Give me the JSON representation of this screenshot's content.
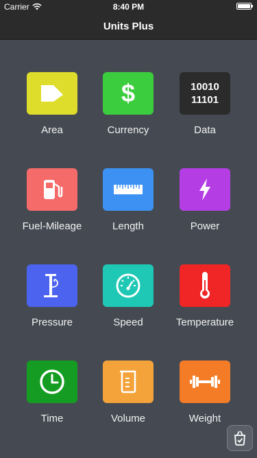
{
  "statusbar": {
    "carrier": "Carrier",
    "time": "8:40 PM",
    "battery_level": 1.0
  },
  "navbar": {
    "title": "Units Plus"
  },
  "tiles": [
    {
      "label": "Area",
      "icon": "area-icon",
      "color": "#dedd2b"
    },
    {
      "label": "Currency",
      "icon": "currency-icon",
      "color": "#3ccd3f",
      "symbol": "$"
    },
    {
      "label": "Data",
      "icon": "data-icon",
      "color": "#2b2b2b",
      "digits_top": "10010",
      "digits_bottom": "11101"
    },
    {
      "label": "Fuel-Mileage",
      "icon": "fuel-pump-icon",
      "color": "#f56b6a"
    },
    {
      "label": "Length",
      "icon": "ruler-icon",
      "color": "#3c91f2"
    },
    {
      "label": "Power",
      "icon": "lightning-icon",
      "color": "#b43ee4"
    },
    {
      "label": "Pressure",
      "icon": "pressure-gauge-icon",
      "color": "#4c63f0"
    },
    {
      "label": "Speed",
      "icon": "speedometer-icon",
      "color": "#1ec8b5"
    },
    {
      "label": "Temperature",
      "icon": "thermometer-icon",
      "color": "#ef2625"
    },
    {
      "label": "Time",
      "icon": "clock-icon",
      "color": "#159c22"
    },
    {
      "label": "Volume",
      "icon": "beaker-icon",
      "color": "#f4a33b"
    },
    {
      "label": "Weight",
      "icon": "dumbbell-icon",
      "color": "#f57c27"
    }
  ],
  "badge": {
    "icon": "app-badge-icon"
  }
}
